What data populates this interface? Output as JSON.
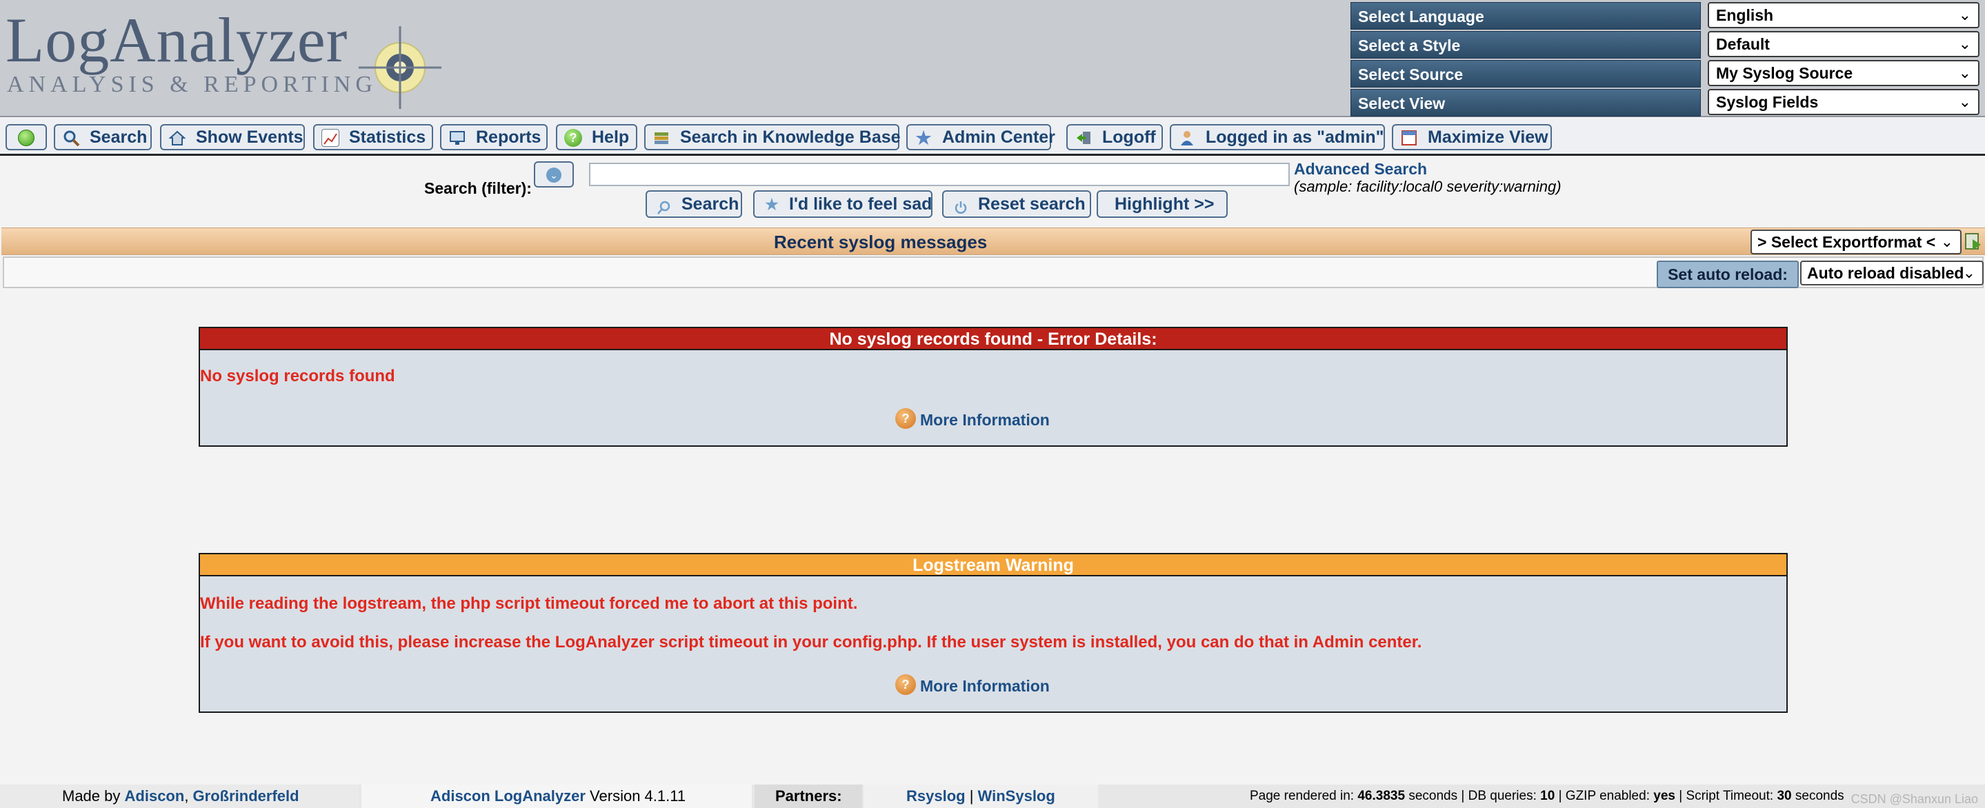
{
  "logo": {
    "title": "LogAnalyzer",
    "subtitle": "ANALYSIS & REPORTING"
  },
  "selectors": [
    {
      "label": "Select Language",
      "value": "English"
    },
    {
      "label": "Select a Style",
      "value": "Default"
    },
    {
      "label": "Select Source",
      "value": "My Syslog Source"
    },
    {
      "label": "Select View",
      "value": "Syslog Fields"
    }
  ],
  "menu": {
    "search": "Search",
    "show_events": "Show Events",
    "statistics": "Statistics",
    "reports": "Reports",
    "help": "Help",
    "kb": "Search in Knowledge Base",
    "admin": "Admin Center",
    "logoff": "Logoff",
    "logged_in": "Logged in as \"admin\"",
    "maximize": "Maximize View"
  },
  "search": {
    "label": "Search (filter):",
    "value": "",
    "advanced": "Advanced Search",
    "sample": "(sample: facility:local0 severity:warning)",
    "btn_search": "Search",
    "btn_lucky": "I'd like to feel sad",
    "btn_reset": "Reset search",
    "btn_highlight": "Highlight >>"
  },
  "titlebar": {
    "title": "Recent syslog messages",
    "export": "> Select Exportformat <"
  },
  "reload": {
    "button": "Set auto reload:",
    "value": "Auto reload disabled"
  },
  "error_panel": {
    "header": "No syslog records found - Error Details:",
    "message": "No syslog records found",
    "more": "More Information",
    "header_color": "#bc2219"
  },
  "warning_panel": {
    "header": "Logstream Warning",
    "line1": "While reading the logstream, the php script timeout forced me to abort at this point.",
    "line2": "If you want to avoid this, please increase the LogAnalyzer script timeout in your config.php. If the user system is installed, you can do that in Admin center.",
    "more": "More Information",
    "header_color": "#f4a63a"
  },
  "footer": {
    "made_by": "Made by",
    "adiscon": "Adiscon",
    "location": "Großrinderfeld",
    "product": "Adiscon LogAnalyzer",
    "version": "Version 4.1.11",
    "partners": "Partners:",
    "rsyslog": "Rsyslog",
    "winsyslog": "WinSyslog",
    "rendered_label": "Page rendered in:",
    "rendered_value": "46.3835",
    "seconds": "seconds",
    "db_label": "DB queries:",
    "db_value": "10",
    "gzip_label": "GZIP enabled:",
    "gzip_value": "yes",
    "timeout_label": "Script Timeout:",
    "timeout_value": "30",
    "watermark": "CSDN @Shanxun Liao"
  }
}
